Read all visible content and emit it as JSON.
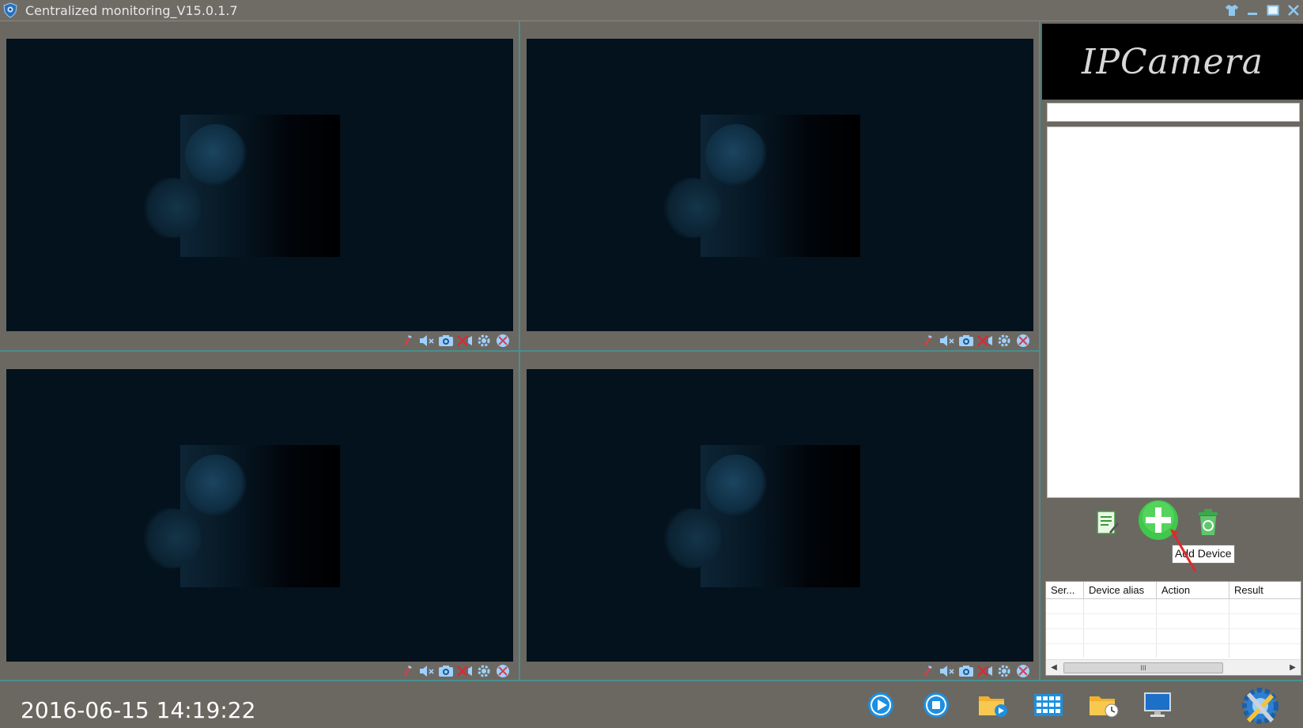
{
  "window": {
    "title": "Centralized monitoring_V15.0.1.7",
    "buttons": [
      "skin-icon",
      "minimize-icon",
      "maximize-icon",
      "close-icon"
    ]
  },
  "panes": [
    {
      "id": 1,
      "toolbar": [
        "mic-icon",
        "speaker-mute-icon",
        "snapshot-icon",
        "close-video-icon",
        "settings-icon",
        "fullscreen-icon"
      ]
    },
    {
      "id": 2,
      "toolbar": [
        "mic-icon",
        "speaker-mute-icon",
        "snapshot-icon",
        "close-video-icon",
        "settings-icon",
        "fullscreen-icon"
      ]
    },
    {
      "id": 3,
      "toolbar": [
        "mic-icon",
        "speaker-mute-icon",
        "snapshot-icon",
        "close-video-icon",
        "settings-icon",
        "fullscreen-icon"
      ]
    },
    {
      "id": 4,
      "toolbar": [
        "mic-icon",
        "speaker-mute-icon",
        "snapshot-icon",
        "close-video-icon",
        "settings-icon",
        "fullscreen-icon"
      ]
    }
  ],
  "sidebar": {
    "brand": "IPCamera",
    "search_value": "",
    "tooltip": "Add Device",
    "actions": [
      "edit-device-icon",
      "add-device-icon",
      "delete-device-icon"
    ]
  },
  "log_table": {
    "columns": [
      "Ser...",
      "Device alias",
      "Action",
      "Result"
    ],
    "scroll_thumb": "III"
  },
  "bottom": {
    "datetime": "2016-06-15 14:19:22",
    "icons": [
      "play-icon",
      "stop-icon",
      "record-folder-icon",
      "grid-layout-icon",
      "schedule-folder-icon",
      "monitor-icon",
      "tools-icon"
    ]
  },
  "colors": {
    "background": "#6b6862",
    "divider": "#4a8e8e",
    "video_bg": "#04121d",
    "accent_blue": "#1d8fe0",
    "add_green": "#35c23a"
  }
}
